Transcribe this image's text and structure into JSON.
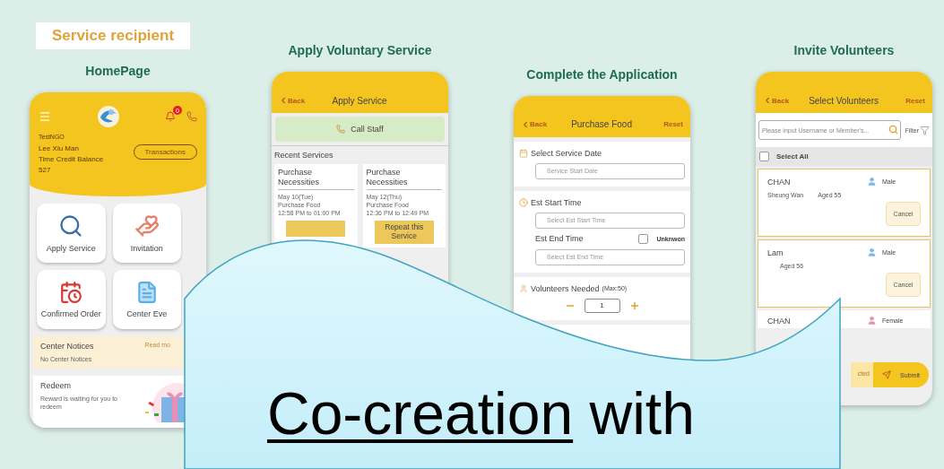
{
  "tag": "Service recipient",
  "screens": [
    {
      "kind": "home",
      "title": "HomePage",
      "badge": "0",
      "org": "TestNGO",
      "user": "Lee Xiu Man",
      "balance_label": "Time Credit Balance",
      "balance": "527",
      "transactions": "Transactions",
      "tiles": [
        {
          "kind": "search",
          "label": "Apply Service"
        },
        {
          "kind": "hands",
          "label": "Invitation"
        },
        {
          "kind": "calendar",
          "label": "Confirmed Order"
        },
        {
          "kind": "document",
          "label": "Center Eve"
        }
      ],
      "notices": {
        "title": "Center Notices",
        "link": "Read mo",
        "body": "No Center Notices"
      },
      "redeem": {
        "title": "Redeem",
        "body": "Reward is waiting for you to redeem"
      }
    },
    {
      "kind": "apply",
      "title": "Apply Voluntary Service",
      "back": "Back",
      "header": "Apply Service",
      "call": "Call Staff",
      "section": "Recent Services",
      "services": [
        {
          "name": "Purchase Necessities",
          "date": "May 10(Tue)",
          "item": "Purchase Food",
          "time": "12:58 PM to 01:00 PM"
        },
        {
          "name": "Purchase Necessities",
          "date": "May 12(Thu)",
          "item": "Purchase Food",
          "time": "12:36 PM to 12:49 PM",
          "button": "Repeat this Service"
        }
      ]
    },
    {
      "kind": "form",
      "title": "Complete the Application",
      "back": "Back",
      "header": "Purchase Food",
      "reset": "Reset",
      "date_label": "Select Service Date",
      "date_placeholder": "Service Start Date",
      "start_label": "Est Start Time",
      "start_placeholder": "Select Est Start Time",
      "end_label": "Est End Time",
      "unknown_label": "Unknwon",
      "unknown_checked": false,
      "end_placeholder": "Select Est End Time",
      "volunteers_label": "Volunteers Needed",
      "volunteers_max": "(Max:50)",
      "count": "1"
    },
    {
      "kind": "invite",
      "title": "Invite Volunteers",
      "back": "Back",
      "header": "Select Volunteers",
      "reset": "Reset",
      "search_placeholder": "Please input Username or Member's...",
      "filter": "Filter",
      "select_all": "Select All",
      "select_all_checked": false,
      "volunteers": [
        {
          "name": "CHAN",
          "gender": "Male",
          "color": "#7db6e8",
          "district": "Sheung Wan",
          "age": "Aged 55",
          "button": "Cancel",
          "selected": true
        },
        {
          "name": "Lam",
          "gender": "Male",
          "color": "#7db6e8",
          "age": "Aged 56",
          "button": "Cancel",
          "selected": true
        },
        {
          "name": "CHAN",
          "gender": "Female",
          "color": "#e68fae",
          "selected": false
        }
      ],
      "selected_text": "cted",
      "submit": "Submit"
    }
  ],
  "banner": {
    "title": [
      {
        "text": "Co-creation",
        "underlined": true
      },
      {
        "text": "with",
        "underlined": false
      }
    ]
  }
}
